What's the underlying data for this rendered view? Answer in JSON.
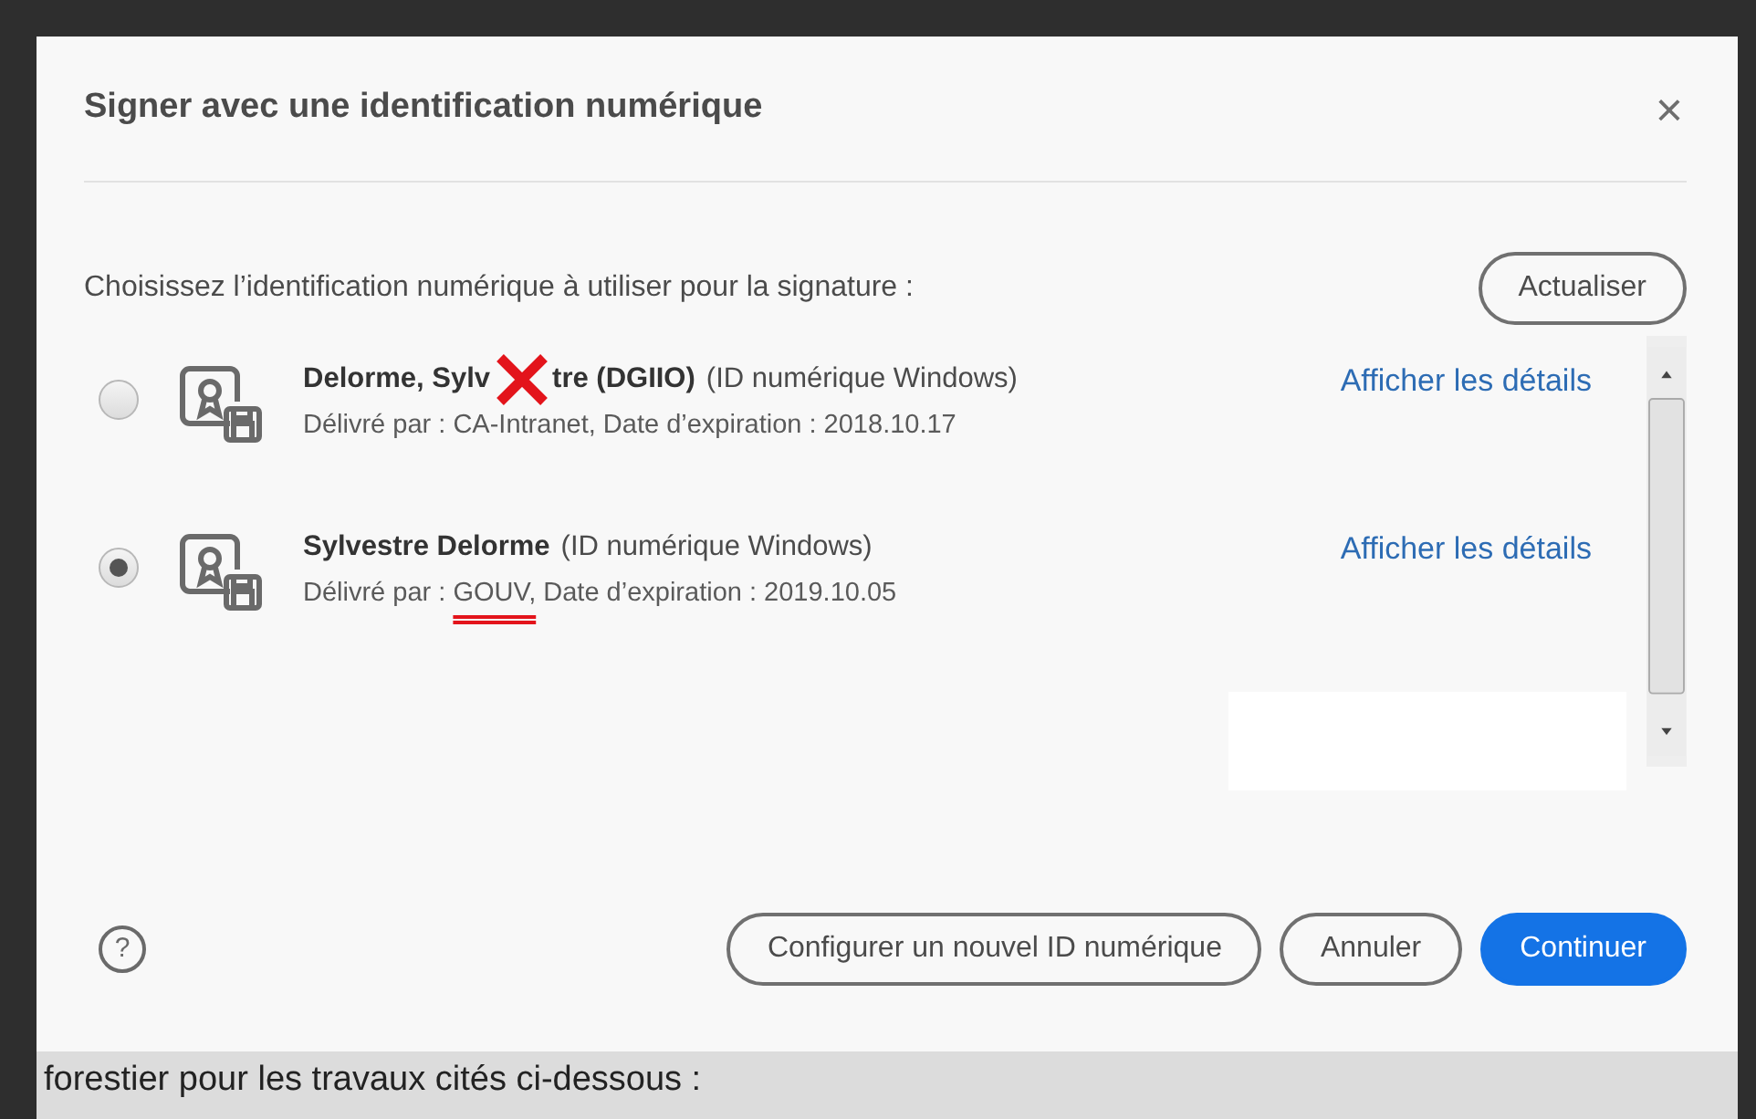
{
  "dialog": {
    "title": "Signer avec une identification numérique",
    "close": "×",
    "prompt": "Choisissez l’identification numérique à utiliser pour la signature :",
    "refresh_button": "Actualiser",
    "ids": [
      {
        "name": [
          "Delorme, Sylv",
          "tre (DGIIO)"
        ],
        "type": "(ID numérique Windows)",
        "issuer_label": "Délivré par :",
        "issuer": "CA-Intranet,",
        "expiry": "Date d’expiration : 2018.10.17",
        "details_link": "Afficher les détails",
        "selected": false,
        "crossed_out": true,
        "issuer_underlined": false
      },
      {
        "name": [
          "Sylvestre Delorme"
        ],
        "type": "(ID numérique Windows)",
        "issuer_label": "Délivré par :",
        "issuer": "GOUV,",
        "expiry": "Date d’expiration : 2019.10.05",
        "details_link": "Afficher les détails",
        "selected": true,
        "crossed_out": false,
        "issuer_underlined": true
      }
    ],
    "help": "?",
    "buttons": [
      {
        "label": "Configurer un nouvel ID numérique",
        "kind": "outline"
      },
      {
        "label": "Annuler",
        "kind": "outline"
      },
      {
        "label": "Continuer",
        "kind": "primary"
      }
    ]
  },
  "background_text": "forestier pour les travaux cités ci-dessous :"
}
